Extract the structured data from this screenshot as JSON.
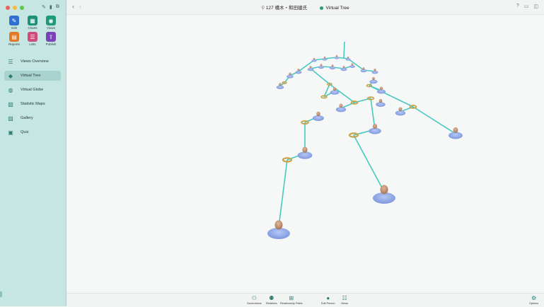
{
  "window": {
    "title_count": "127",
    "title_name": "橋木・和田建氏",
    "title_view": "Virtual Tree"
  },
  "toolbar": {
    "tools": [
      {
        "label": "Edit",
        "icon": "pencil-icon",
        "color": "#2f6fd0"
      },
      {
        "label": "Charts",
        "icon": "charts-icon",
        "color": "#1f8f7a"
      },
      {
        "label": "Views",
        "icon": "eye-icon",
        "color": "#1e9a76"
      },
      {
        "label": "Reports",
        "icon": "reports-icon",
        "color": "#e07a28"
      },
      {
        "label": "Lists",
        "icon": "lists-icon",
        "color": "#d04a7a"
      },
      {
        "label": "Publish",
        "icon": "publish-icon",
        "color": "#7a44b8"
      }
    ]
  },
  "sidebar": {
    "items": [
      {
        "label": "Views Overview",
        "icon": "list-icon",
        "active": false
      },
      {
        "label": "Virtual Tree",
        "icon": "cube-icon",
        "active": true
      },
      {
        "label": "Virtual Globe",
        "icon": "globe-icon",
        "active": false
      },
      {
        "label": "Statistic Maps",
        "icon": "map-icon",
        "active": false
      },
      {
        "label": "Gallery",
        "icon": "gallery-icon",
        "active": false
      },
      {
        "label": "Quiz",
        "icon": "quiz-icon",
        "active": false
      }
    ]
  },
  "bottombar": {
    "buttons": [
      {
        "label": "Generations",
        "icon": "generations-icon"
      },
      {
        "label": "Relatives",
        "icon": "relatives-icon"
      },
      {
        "label": "Relationship Paths",
        "icon": "relationship-paths-icon"
      },
      {
        "label": "Edit Person",
        "icon": "edit-person-icon"
      },
      {
        "label": "Views",
        "icon": "views-icon"
      },
      {
        "label": "Options",
        "icon": "options-icon"
      }
    ]
  },
  "colors": {
    "accent": "#1e9a76",
    "link": "#48c9c0",
    "figure": "#8fa9ea",
    "ring": "#c9a248"
  }
}
